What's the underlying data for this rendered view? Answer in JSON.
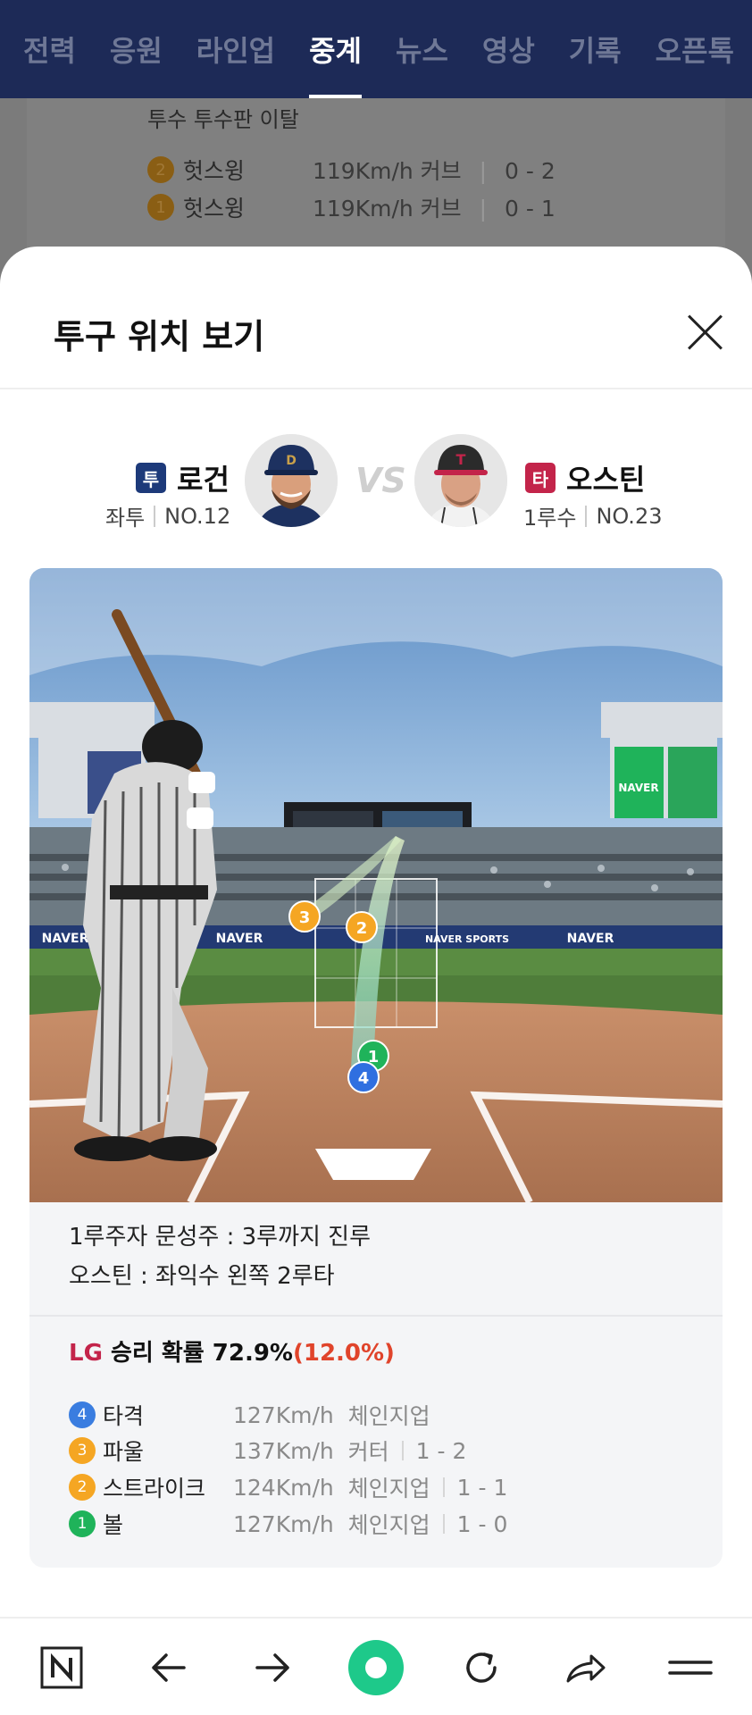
{
  "nav": {
    "tabs": [
      "전력",
      "응원",
      "라인업",
      "중계",
      "뉴스",
      "영상",
      "기록",
      "오픈톡"
    ],
    "active_index": 3
  },
  "background": {
    "heading": "투수 투수판 이탈",
    "rows": [
      {
        "num": "2",
        "result": "헛스윙",
        "desc": "119Km/h  커브",
        "count": "0 - 2"
      },
      {
        "num": "1",
        "result": "헛스윙",
        "desc": "119Km/h  커브",
        "count": "0 - 1"
      }
    ]
  },
  "sheet": {
    "title": "투구 위치 보기",
    "close_icon": "close-icon"
  },
  "matchup": {
    "pitcher": {
      "role": "투",
      "name": "로건",
      "position": "좌투",
      "number": "NO.12",
      "badge_color": "#1d3a7a"
    },
    "vs": "VS",
    "batter": {
      "role": "타",
      "name": "오스틴",
      "position": "1루수",
      "number": "NO.23",
      "badge_color": "#c3244a"
    }
  },
  "scene": {
    "banner": "NAVER",
    "banner_sports": "NAVER SPORTS",
    "markers": [
      {
        "num": "3",
        "color": "#f5a623"
      },
      {
        "num": "2",
        "color": "#f5a623"
      },
      {
        "num": "1",
        "color": "#1fb35a"
      },
      {
        "num": "4",
        "color": "#2f6fe0"
      }
    ]
  },
  "play": {
    "line1": "1루주자 문성주 : 3루까지 진루",
    "line2": "오스틴 : 좌익수 왼쪽 2루타",
    "win_team": "LG",
    "win_label": " 승리 확률 72.9%",
    "win_delta": "(12.0%)"
  },
  "pitches": [
    {
      "num": "4",
      "color": "#3a7de0",
      "result": "타격",
      "speed": "127Km/h",
      "type": "체인지업",
      "count": ""
    },
    {
      "num": "3",
      "color": "#f5a623",
      "result": "파울",
      "speed": "137Km/h",
      "type": "커터",
      "count": "1 - 2"
    },
    {
      "num": "2",
      "color": "#f5a623",
      "result": "스트라이크",
      "speed": "124Km/h",
      "type": "체인지업",
      "count": "1 - 1"
    },
    {
      "num": "1",
      "color": "#1fb35a",
      "result": "볼",
      "speed": "127Km/h",
      "type": "체인지업",
      "count": "1 - 0"
    }
  ],
  "bottom_bar": [
    "naver-home-icon",
    "back-arrow-icon",
    "forward-arrow-icon",
    "green-dot-icon",
    "reload-icon",
    "share-icon",
    "menu-icon"
  ]
}
